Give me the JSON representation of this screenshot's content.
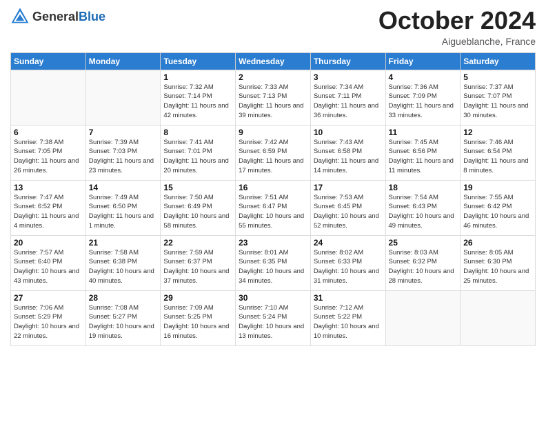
{
  "header": {
    "logo_general": "General",
    "logo_blue": "Blue",
    "month": "October 2024",
    "location": "Aigueblanche, France"
  },
  "days_of_week": [
    "Sunday",
    "Monday",
    "Tuesday",
    "Wednesday",
    "Thursday",
    "Friday",
    "Saturday"
  ],
  "weeks": [
    [
      {
        "day": "",
        "info": ""
      },
      {
        "day": "",
        "info": ""
      },
      {
        "day": "1",
        "info": "Sunrise: 7:32 AM\nSunset: 7:14 PM\nDaylight: 11 hours and 42 minutes."
      },
      {
        "day": "2",
        "info": "Sunrise: 7:33 AM\nSunset: 7:13 PM\nDaylight: 11 hours and 39 minutes."
      },
      {
        "day": "3",
        "info": "Sunrise: 7:34 AM\nSunset: 7:11 PM\nDaylight: 11 hours and 36 minutes."
      },
      {
        "day": "4",
        "info": "Sunrise: 7:36 AM\nSunset: 7:09 PM\nDaylight: 11 hours and 33 minutes."
      },
      {
        "day": "5",
        "info": "Sunrise: 7:37 AM\nSunset: 7:07 PM\nDaylight: 11 hours and 30 minutes."
      }
    ],
    [
      {
        "day": "6",
        "info": "Sunrise: 7:38 AM\nSunset: 7:05 PM\nDaylight: 11 hours and 26 minutes."
      },
      {
        "day": "7",
        "info": "Sunrise: 7:39 AM\nSunset: 7:03 PM\nDaylight: 11 hours and 23 minutes."
      },
      {
        "day": "8",
        "info": "Sunrise: 7:41 AM\nSunset: 7:01 PM\nDaylight: 11 hours and 20 minutes."
      },
      {
        "day": "9",
        "info": "Sunrise: 7:42 AM\nSunset: 6:59 PM\nDaylight: 11 hours and 17 minutes."
      },
      {
        "day": "10",
        "info": "Sunrise: 7:43 AM\nSunset: 6:58 PM\nDaylight: 11 hours and 14 minutes."
      },
      {
        "day": "11",
        "info": "Sunrise: 7:45 AM\nSunset: 6:56 PM\nDaylight: 11 hours and 11 minutes."
      },
      {
        "day": "12",
        "info": "Sunrise: 7:46 AM\nSunset: 6:54 PM\nDaylight: 11 hours and 8 minutes."
      }
    ],
    [
      {
        "day": "13",
        "info": "Sunrise: 7:47 AM\nSunset: 6:52 PM\nDaylight: 11 hours and 4 minutes."
      },
      {
        "day": "14",
        "info": "Sunrise: 7:49 AM\nSunset: 6:50 PM\nDaylight: 11 hours and 1 minute."
      },
      {
        "day": "15",
        "info": "Sunrise: 7:50 AM\nSunset: 6:49 PM\nDaylight: 10 hours and 58 minutes."
      },
      {
        "day": "16",
        "info": "Sunrise: 7:51 AM\nSunset: 6:47 PM\nDaylight: 10 hours and 55 minutes."
      },
      {
        "day": "17",
        "info": "Sunrise: 7:53 AM\nSunset: 6:45 PM\nDaylight: 10 hours and 52 minutes."
      },
      {
        "day": "18",
        "info": "Sunrise: 7:54 AM\nSunset: 6:43 PM\nDaylight: 10 hours and 49 minutes."
      },
      {
        "day": "19",
        "info": "Sunrise: 7:55 AM\nSunset: 6:42 PM\nDaylight: 10 hours and 46 minutes."
      }
    ],
    [
      {
        "day": "20",
        "info": "Sunrise: 7:57 AM\nSunset: 6:40 PM\nDaylight: 10 hours and 43 minutes."
      },
      {
        "day": "21",
        "info": "Sunrise: 7:58 AM\nSunset: 6:38 PM\nDaylight: 10 hours and 40 minutes."
      },
      {
        "day": "22",
        "info": "Sunrise: 7:59 AM\nSunset: 6:37 PM\nDaylight: 10 hours and 37 minutes."
      },
      {
        "day": "23",
        "info": "Sunrise: 8:01 AM\nSunset: 6:35 PM\nDaylight: 10 hours and 34 minutes."
      },
      {
        "day": "24",
        "info": "Sunrise: 8:02 AM\nSunset: 6:33 PM\nDaylight: 10 hours and 31 minutes."
      },
      {
        "day": "25",
        "info": "Sunrise: 8:03 AM\nSunset: 6:32 PM\nDaylight: 10 hours and 28 minutes."
      },
      {
        "day": "26",
        "info": "Sunrise: 8:05 AM\nSunset: 6:30 PM\nDaylight: 10 hours and 25 minutes."
      }
    ],
    [
      {
        "day": "27",
        "info": "Sunrise: 7:06 AM\nSunset: 5:29 PM\nDaylight: 10 hours and 22 minutes."
      },
      {
        "day": "28",
        "info": "Sunrise: 7:08 AM\nSunset: 5:27 PM\nDaylight: 10 hours and 19 minutes."
      },
      {
        "day": "29",
        "info": "Sunrise: 7:09 AM\nSunset: 5:25 PM\nDaylight: 10 hours and 16 minutes."
      },
      {
        "day": "30",
        "info": "Sunrise: 7:10 AM\nSunset: 5:24 PM\nDaylight: 10 hours and 13 minutes."
      },
      {
        "day": "31",
        "info": "Sunrise: 7:12 AM\nSunset: 5:22 PM\nDaylight: 10 hours and 10 minutes."
      },
      {
        "day": "",
        "info": ""
      },
      {
        "day": "",
        "info": ""
      }
    ]
  ]
}
